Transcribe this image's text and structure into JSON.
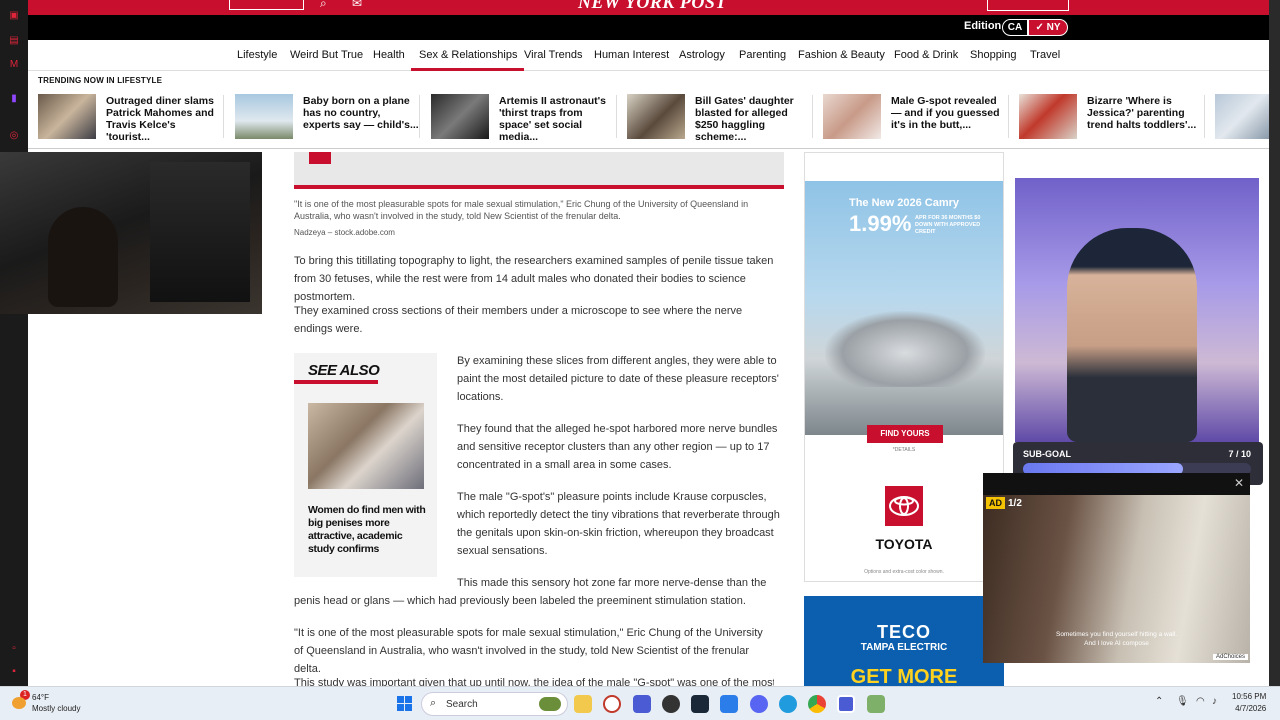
{
  "site": {
    "logo": "NEW YORK POST",
    "edition_label": "Edition",
    "editions": [
      "CA",
      "✓ NY"
    ]
  },
  "nav": {
    "items": [
      "Lifestyle",
      "Weird But True",
      "Health",
      "Sex & Relationships",
      "Viral Trends",
      "Human Interest",
      "Astrology",
      "Parenting",
      "Fashion & Beauty",
      "Food & Drink",
      "Shopping",
      "Travel"
    ],
    "active": "Sex & Relationships"
  },
  "trending": {
    "label": "TRENDING NOW IN LIFESTYLE",
    "items": [
      "Outraged diner slams Patrick Mahomes and Travis Kelce's 'tourist...",
      "Baby born on a plane has no country, experts say — child's...",
      "Artemis II astronaut's 'thirst traps from space' set social media...",
      "Bill Gates' daughter blasted for alleged $250 haggling scheme:...",
      "Male G-spot revealed — and if you guessed it's in the butt,...",
      "Bizarre 'Where is Jessica?' parenting trend halts toddlers'..."
    ]
  },
  "article": {
    "caption": "\"It is one of the most pleasurable spots for male sexual stimulation,\" Eric Chung of the University of Queensland in Australia, who wasn't involved in the study, told New Scientist of the frenular delta.",
    "credit": "Nadzeya – stock.adobe.com",
    "p1": "To bring this titillating topography to light, the researchers examined samples of penile tissue taken from 30 fetuses, while the rest were from 14 adult males who donated their bodies to science postmortem.",
    "p2": "They examined cross sections of their members under a microscope to see where the nerve endings were.",
    "p3": "By examining these slices from different angles, they were able to paint the most detailed picture to date of these pleasure receptors' locations.",
    "p4": "They found that the alleged he-spot harbored more nerve bundles and sensitive receptor clusters than any other region — up to 17 concentrated in a small area in some cases.",
    "p5": "The male \"G-spot's\" pleasure points include Krause corpuscles, which reportedly detect the tiny vibrations that reverberate through the genitals upon skin-on-skin friction, whereupon they broadcast sexual sensations.",
    "p6": "This made this sensory hot zone far more nerve-dense than the penis head or glans — which had previously been labeled the preeminent stimulation station.",
    "p7": "\"It is one of the most pleasurable spots for male sexual stimulation,\" Eric Chung of the University of Queensland in Australia, who wasn't involved in the study, told New Scientist of the frenular delta.",
    "p8": "This study was important given that up until now, the idea of the male \"G-spot\" was one of the most"
  },
  "see_also": {
    "title": "SEE ALSO",
    "headline": "Women do find men with big penises more attractive, academic study confirms"
  },
  "ads": {
    "camry_title": "The New 2026 Camry",
    "camry_rate": "1.99%",
    "camry_sub": "APR FOR 36 MONTHS $0 DOWN WITH APPROVED CREDIT",
    "camry_cta": "FIND YOURS",
    "camry_details": "*DETAILS",
    "toyota": "TOYOTA",
    "toyota_fine": "Options and extra-cost color shown.",
    "teco_name": "TECO",
    "teco_sub": "TAMPA ELECTRIC",
    "teco_cta": "GET MORE"
  },
  "overlay": {
    "subgoal_label": "SUB-GOAL",
    "subgoal_count": "7 / 10",
    "subgoal_progress": 0.7,
    "ad_badge": "AD",
    "ad_count": "1/2",
    "video_sub1": "Sometimes you find yourself hitting a wall.",
    "video_sub2": "And I love AI compose",
    "adchoices": "AdChoices"
  },
  "taskbar": {
    "notif": "1",
    "temp": "64°F",
    "weather": "Mostly cloudy",
    "search": "Search",
    "time": "10:56 PM",
    "date": "4/7/2026"
  },
  "colors": {
    "brand_red": "#c8102e",
    "taskbar": "#e8eef5"
  }
}
